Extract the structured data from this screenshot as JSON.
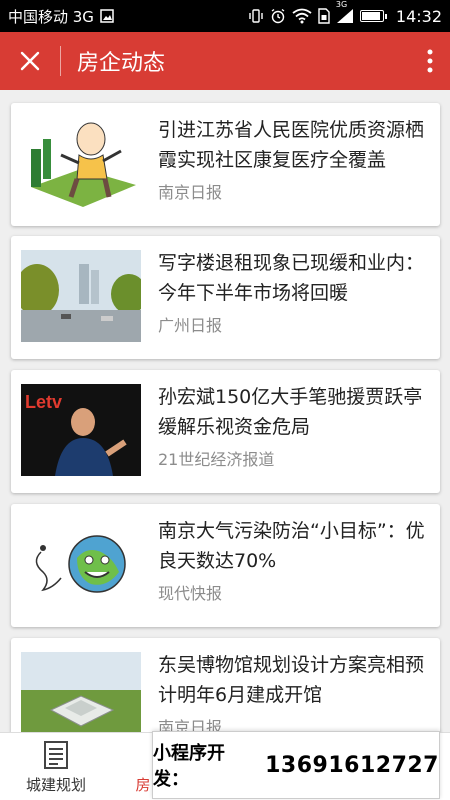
{
  "status_bar": {
    "carrier": "中国移动 3G",
    "network": "3G",
    "time": "14:32",
    "battery_level": 0.82,
    "icons": [
      "image-icon",
      "vibrate-icon",
      "alarm-icon",
      "wifi-icon",
      "sim-icon",
      "signal-icon",
      "battery-icon"
    ]
  },
  "app_bar": {
    "title": "房企动态",
    "close_icon": "close-icon",
    "more_icon": "more-vertical-icon",
    "background": "#d83c34"
  },
  "articles": [
    {
      "title": "引进江苏省人民医院优质资源栖霞实现社区康复医疗全覆盖",
      "source": "南京日报"
    },
    {
      "title": "写字楼退租现象已现缓和业内：今年下半年市场将回暖",
      "source": "广州日报"
    },
    {
      "title": "孙宏斌150亿大手笔驰援贾跃亭缓解乐视资金危局",
      "source": "21世纪经济报道",
      "image_text": "Letv"
    },
    {
      "title": "南京大气污染防治“小目标”：优良天数达70%",
      "source": "现代快报"
    },
    {
      "title": "东吴博物馆规划设计方案亮相预计明年6月建成开馆",
      "source": "南京日报"
    }
  ],
  "tab_bar": {
    "tabs": [
      {
        "label": "城建规划",
        "icon": "document-icon",
        "active": false
      },
      {
        "label": "房",
        "icon": "",
        "active": true
      }
    ]
  },
  "promo": {
    "label": "小程序开发：",
    "phone": "13691612727"
  }
}
